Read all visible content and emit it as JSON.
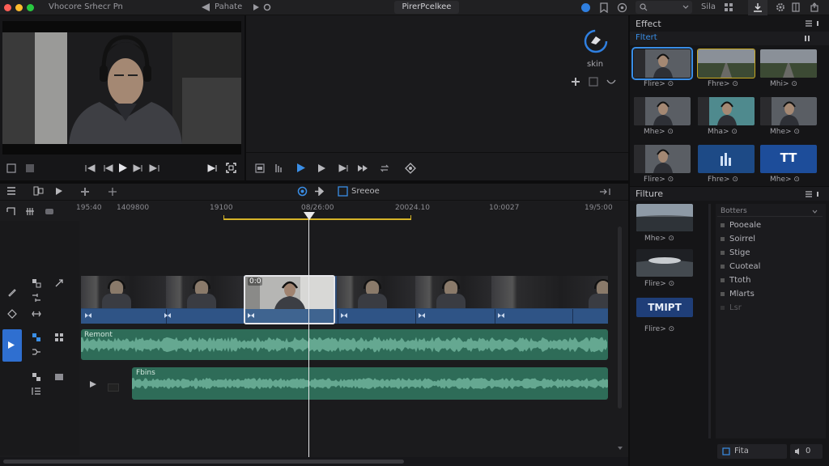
{
  "titlebar": {
    "app_title": "Vhocore Srhecr Pn",
    "share_label": "Pahate",
    "center_title": "PirerPcelkee",
    "right_label": "Sila"
  },
  "viewer": {
    "controls": [
      "prev-frame",
      "play",
      "next-frame"
    ]
  },
  "secondary_viewer": {
    "mode_label": "skin"
  },
  "timeline": {
    "tool_label": "Sreeoe",
    "ruler": [
      "195:40",
      "1409800",
      "19100",
      "08/26:00",
      "20024.10",
      "10:0027",
      "19/5:00"
    ],
    "clip_badge": "0:0",
    "audio_track_1_label": "Remont",
    "audio_track_2_label": "Fbins"
  },
  "effects_panel": {
    "title": "Effect",
    "tab": "Fltert",
    "items": [
      {
        "caption": "Flire> ⊙",
        "selected": true
      },
      {
        "caption": "Fhre> ⊙",
        "selected": false
      },
      {
        "caption": "Mhi> ⊙",
        "selected": false
      },
      {
        "caption": "Mhe> ⊙",
        "selected": false
      },
      {
        "caption": "Mha> ⊙",
        "selected": false
      },
      {
        "caption": "Mhe> ⊙",
        "selected": false
      },
      {
        "caption": "Flire> ⊙",
        "selected": false
      },
      {
        "caption": "Fhre> ⊙",
        "selected": false
      },
      {
        "caption": "Mhe> ⊙",
        "selected": false
      }
    ],
    "tt_label": "TT"
  },
  "filters_panel": {
    "title": "Filture",
    "items": [
      {
        "caption": "Mhe> ⊙"
      },
      {
        "caption": "Flire> ⊙"
      },
      {
        "caption": "Flire> ⊙"
      }
    ],
    "tmipt_label": "TMIPT",
    "dropdown_label": "Botters",
    "list": [
      "Pooeale",
      "Soirrel",
      "Stige",
      "Cuoteal",
      "Ttoth",
      "Mlarts",
      "Lsr"
    ],
    "footer_left": "Fita",
    "footer_right": "0"
  },
  "colors": {
    "accent": "#3a8ee6",
    "video_clip": "#2f5486",
    "audio_clip": "#2e6c58",
    "ruler_in_out": "#d6b428"
  }
}
